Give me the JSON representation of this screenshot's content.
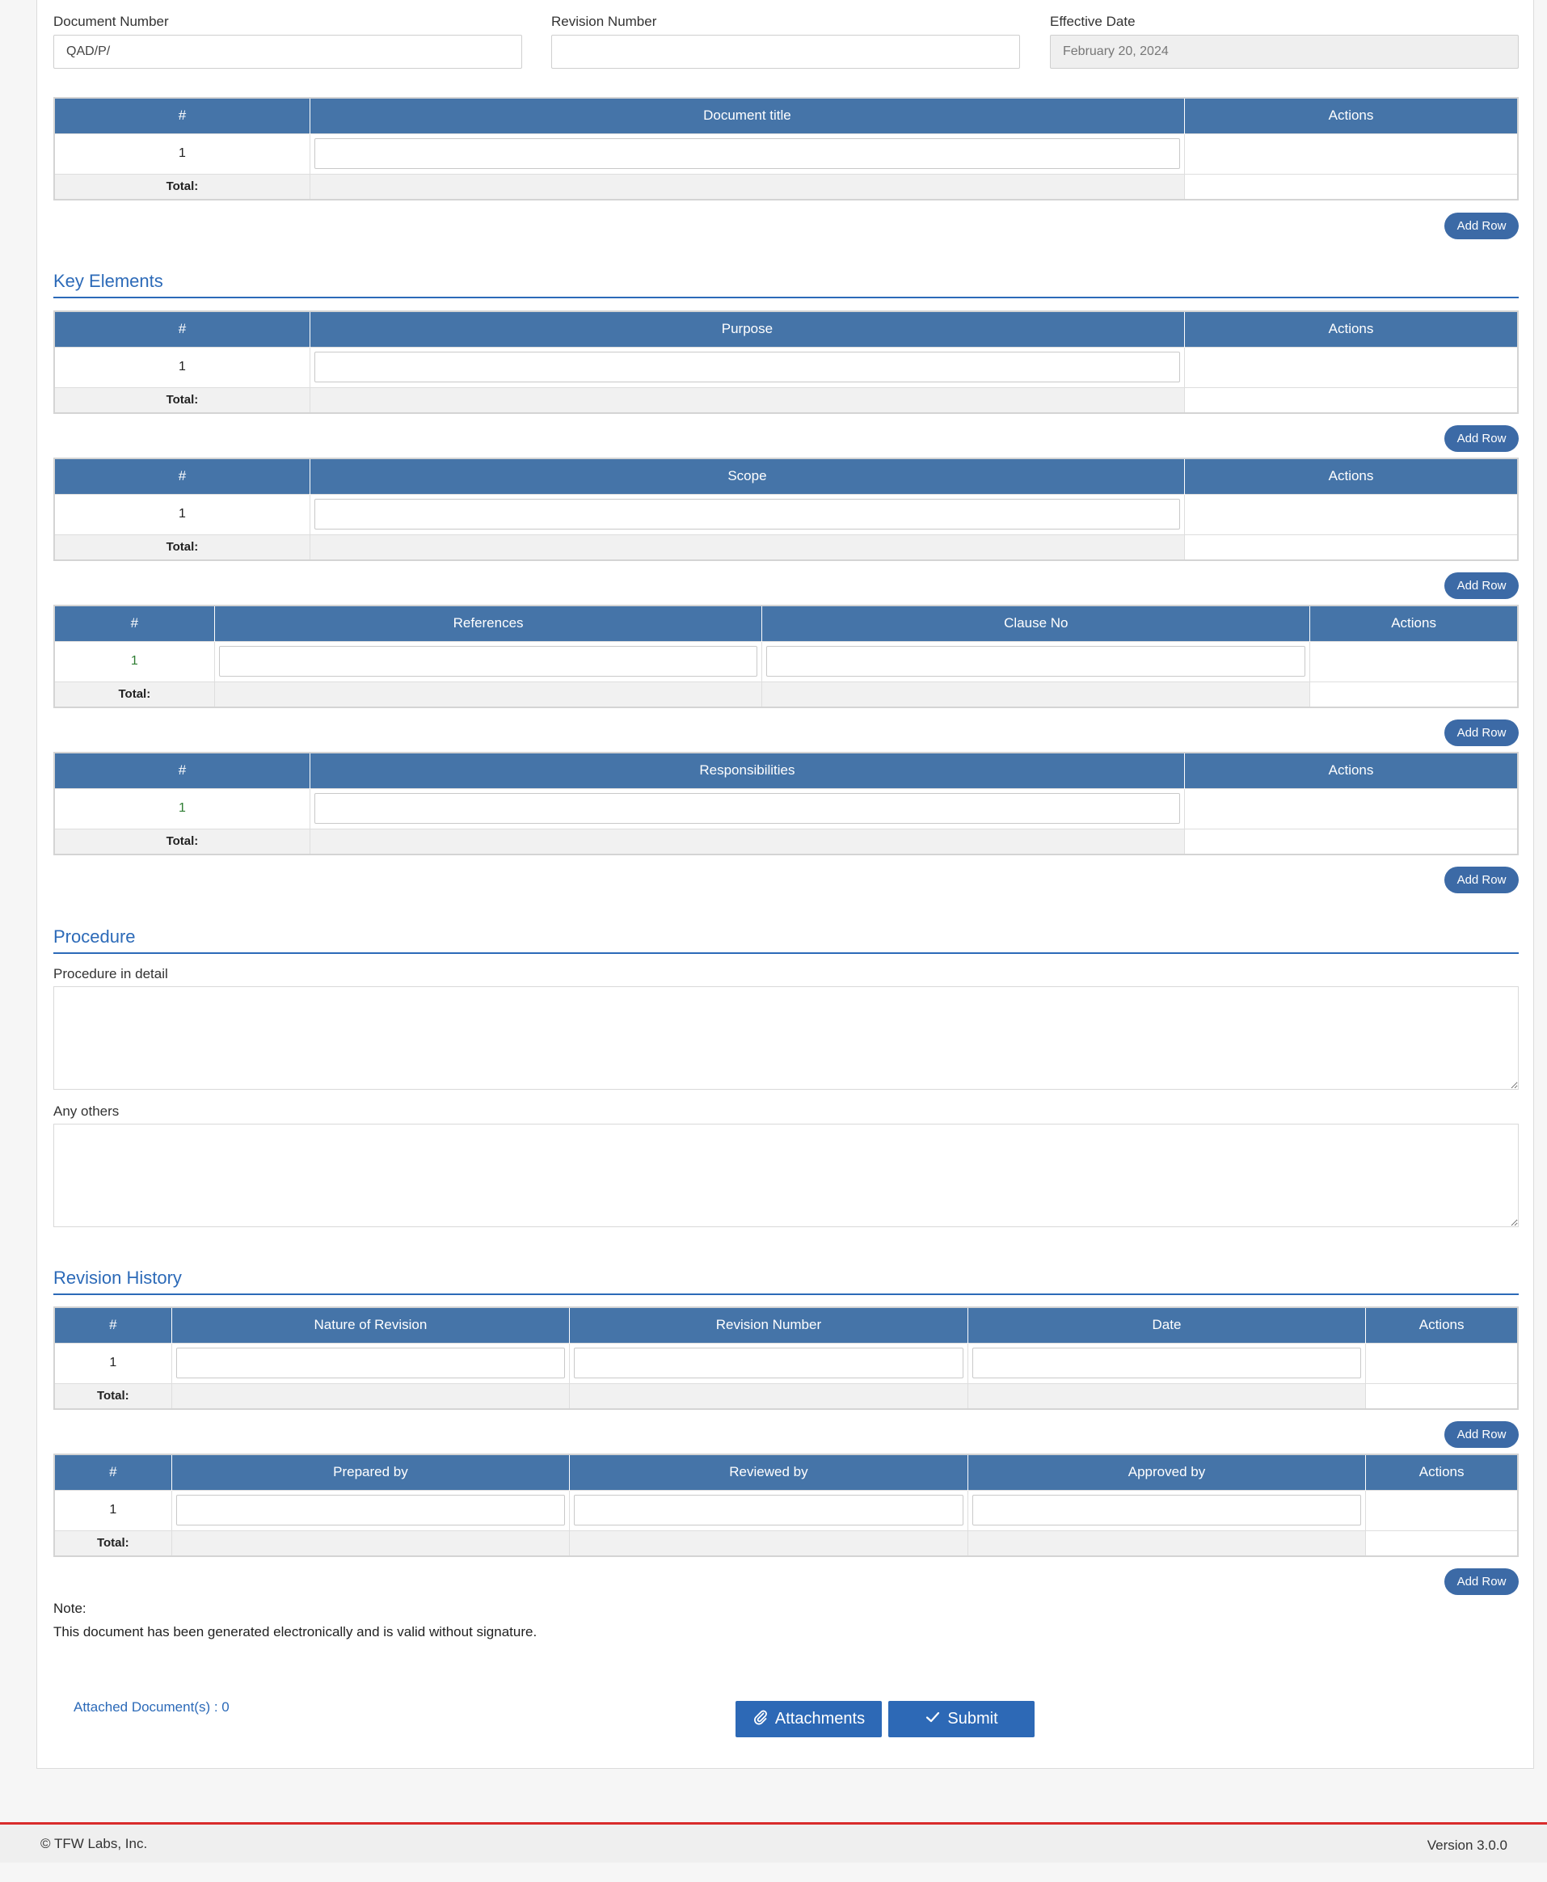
{
  "header_fields": {
    "document_number": {
      "label": "Document Number",
      "value": "QAD/P/"
    },
    "revision_number": {
      "label": "Revision Number",
      "value": ""
    },
    "effective_date": {
      "label": "Effective Date",
      "value": "February 20, 2024"
    }
  },
  "tables": {
    "document_title": {
      "cols": [
        "#",
        "Document title",
        "Actions"
      ],
      "row_no": "1",
      "total": "Total:"
    },
    "purpose": {
      "cols": [
        "#",
        "Purpose",
        "Actions"
      ],
      "row_no": "1",
      "total": "Total:"
    },
    "scope": {
      "cols": [
        "#",
        "Scope",
        "Actions"
      ],
      "row_no": "1",
      "total": "Total:"
    },
    "references": {
      "cols": [
        "#",
        "References",
        "Clause No",
        "Actions"
      ],
      "row_no": "1",
      "total": "Total:"
    },
    "responsibilities": {
      "cols": [
        "#",
        "Responsibilities",
        "Actions"
      ],
      "row_no": "1",
      "total": "Total:"
    },
    "revision_history": {
      "cols": [
        "#",
        "Nature of Revision",
        "Revision Number",
        "Date",
        "Actions"
      ],
      "row_no": "1",
      "total": "Total:"
    },
    "signoff": {
      "cols": [
        "#",
        "Prepared by",
        "Reviewed by",
        "Approved by",
        "Actions"
      ],
      "row_no": "1",
      "total": "Total:"
    }
  },
  "add_row_label": "Add Row",
  "sections": {
    "key_elements": "Key Elements",
    "procedure": "Procedure",
    "revision_history": "Revision History"
  },
  "procedure": {
    "detail_label": "Procedure in detail",
    "others_label": "Any others"
  },
  "note": {
    "label": "Note:",
    "text": "This document has been generated electronically and is valid without signature."
  },
  "actions": {
    "attached_docs": "Attached Document(s) : 0",
    "attachments": "Attachments",
    "submit": "Submit"
  },
  "footer": {
    "copyright": "© TFW Labs, Inc.",
    "version": "Version 3.0.0"
  },
  "colors": {
    "header_blue": "#4574a8",
    "section_blue": "#2c6ab8",
    "button_blue": "#2d69b6",
    "footer_red": "#d92c2c"
  }
}
